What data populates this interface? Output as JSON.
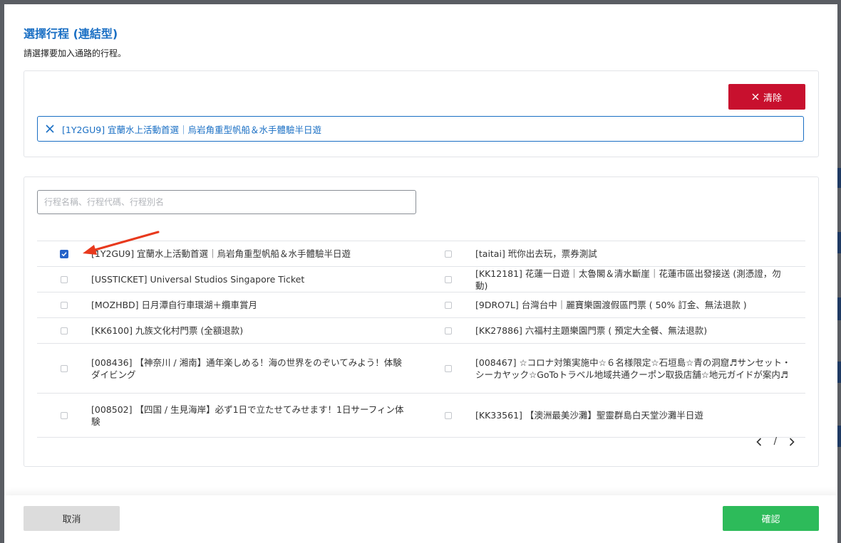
{
  "modal": {
    "title": "選擇行程 (連結型)",
    "subtitle": "請選擇要加入通路的行程。"
  },
  "selected": {
    "clear_label": "清除",
    "chip_text": "[1Y2GU9] 宜蘭水上活動首選｜烏岩角重型帆船＆水手體驗半日遊"
  },
  "search": {
    "placeholder": "行程名稱、行程代碼、行程別名",
    "value": ""
  },
  "rows": [
    {
      "left": {
        "label": "[1Y2GU9] 宜蘭水上活動首選｜烏岩角重型帆船＆水手體驗半日遊",
        "checked": true
      },
      "right": {
        "label": "[taitai] 玳你出去玩，票券測試",
        "checked": false
      }
    },
    {
      "left": {
        "label": "[USSTICKET] Universal Studios Singapore Ticket",
        "checked": false
      },
      "right": {
        "label": "[KK12181] 花蓮一日遊｜太魯閣＆清水斷崖｜花蓮市區出發接送 (測憑證，勿動)",
        "checked": false
      }
    },
    {
      "left": {
        "label": "[MOZHBD] 日月潭自行車環湖＋纜車賞月",
        "checked": false
      },
      "right": {
        "label": "[9DRO7L] 台灣台中｜麗寶樂園渡假區門票 ( 50% 訂金、無法退款 )",
        "checked": false
      }
    },
    {
      "left": {
        "label": "[KK6100] 九族文化村門票 (全額退款)",
        "checked": false
      },
      "right": {
        "label": "[KK27886] 六福村主題樂園門票 ( 預定大全餐、無法退款)",
        "checked": false
      }
    },
    {
      "left": {
        "label": "[008436] 【神奈川 / 湘南】通年楽しめる！海の世界をのぞいてみよう！体験ダイビング",
        "checked": false
      },
      "right": {
        "label": "[008467] ☆コロナ対策実施中☆６名様限定☆石垣島☆青の洞窟♬サンセット・シーカヤック☆GoToトラベル地域共通クーポン取扱店舗☆地元ガイドが案内♬",
        "checked": false
      }
    },
    {
      "left": {
        "label": "[008502] 【四国 / 生見海岸】必ず1日で立たせてみせます！1日サーフィン体験",
        "checked": false
      },
      "right": {
        "label": "[KK33561] 【澳洲最美沙灘】聖靈群島白天堂沙灘半日遊",
        "checked": false
      }
    }
  ],
  "pager": {
    "separator": "/"
  },
  "footer": {
    "cancel_label": "取消",
    "confirm_label": "確認"
  },
  "colors": {
    "accent": "#1a6fc4",
    "danger": "#c8102e",
    "success": "#2dbb5a",
    "checkbox": "#2563c9",
    "annotation_arrow": "#e8391d"
  },
  "icons": {
    "clear": "close-icon",
    "chip_remove": "close-icon",
    "check": "check-icon",
    "prev": "chevron-left-icon",
    "next": "chevron-right-icon",
    "annotation": "red-arrow-icon"
  }
}
